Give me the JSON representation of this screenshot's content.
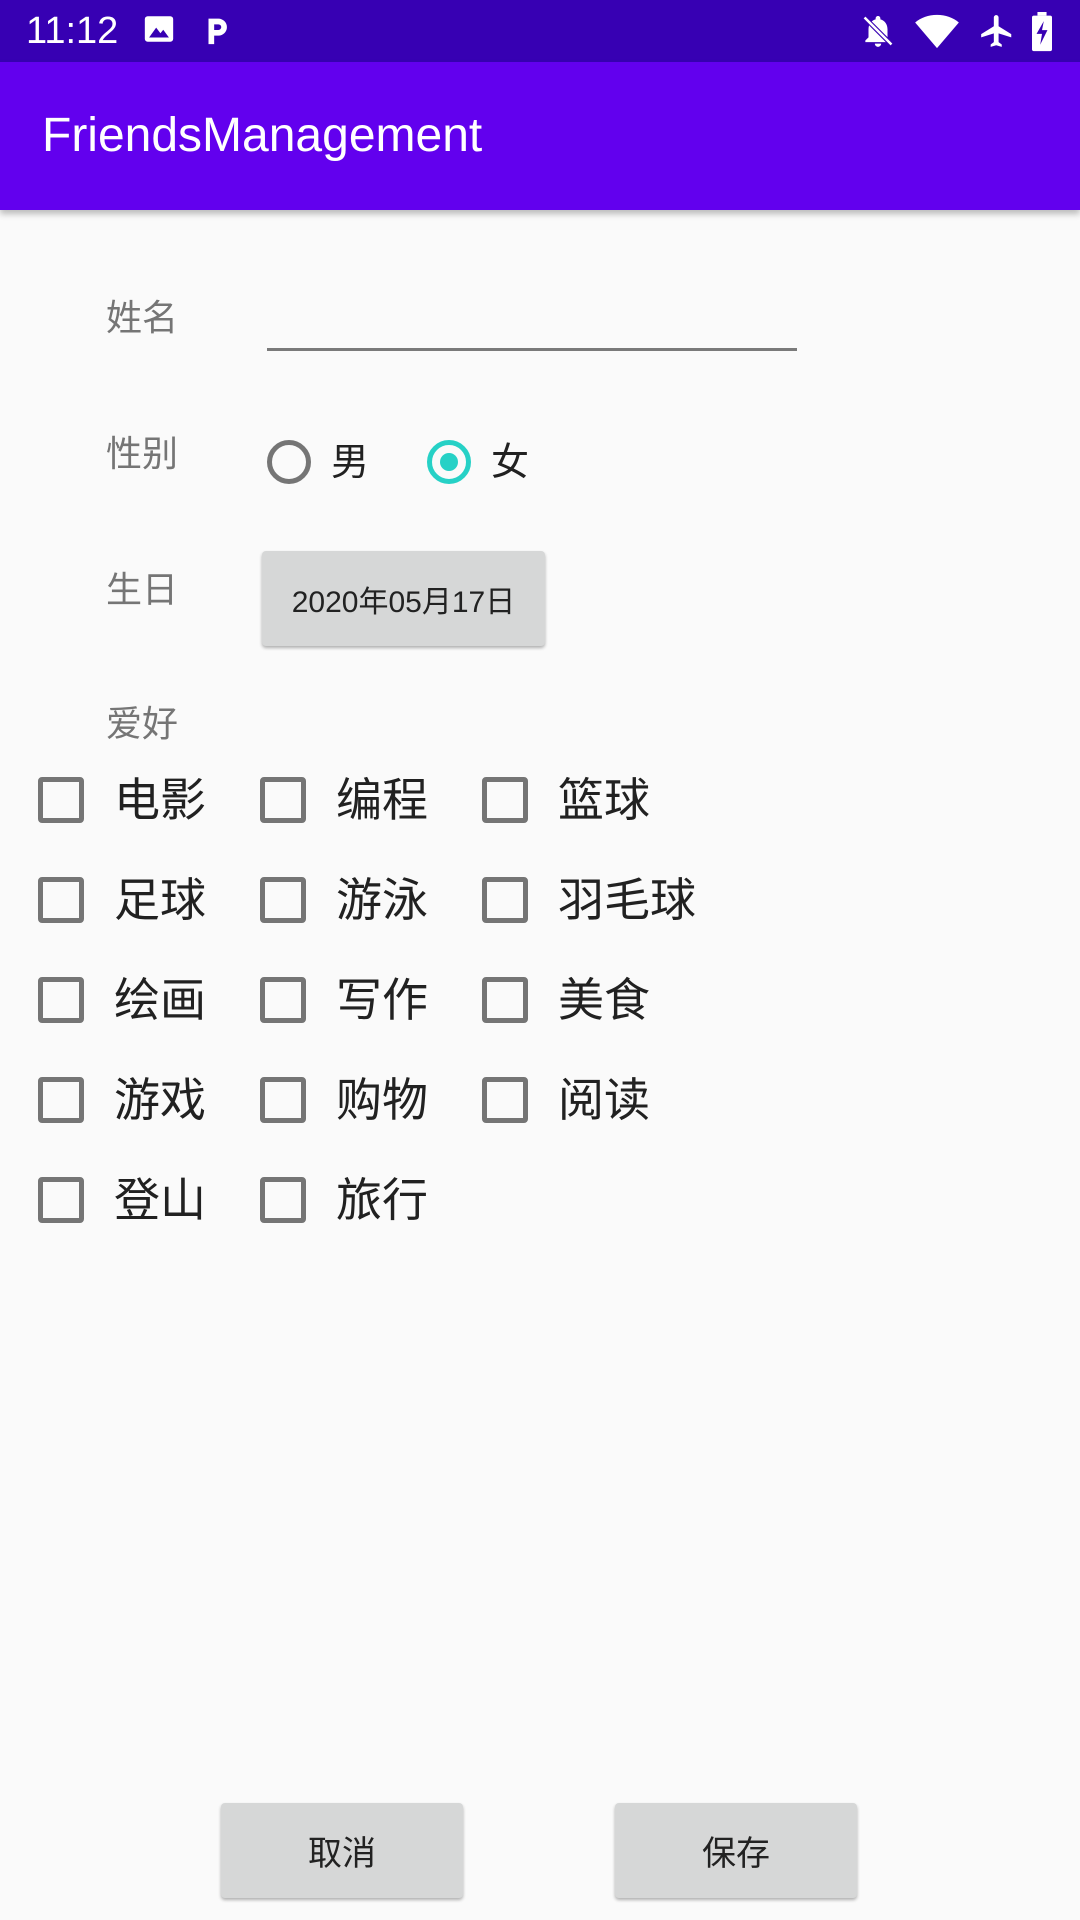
{
  "status_bar": {
    "time": "11:12",
    "icons": [
      "image-icon",
      "parking-icon",
      "notifications-off-icon",
      "wifi-icon",
      "airplane-icon",
      "battery-charging-icon"
    ]
  },
  "app_bar": {
    "title": "FriendsManagement"
  },
  "form": {
    "name_label": "姓名",
    "name_value": "",
    "gender_label": "性别",
    "gender_options": [
      "男",
      "女"
    ],
    "gender_selected": "女",
    "birthday_label": "生日",
    "birthday_value": "2020年05月17日",
    "hobbies_label": "爱好",
    "hobbies": [
      "电影",
      "编程",
      "篮球",
      "足球",
      "游泳",
      "羽毛球",
      "绘画",
      "写作",
      "美食",
      "游戏",
      "购物",
      "阅读",
      "登山",
      "旅行"
    ]
  },
  "actions": {
    "cancel_label": "取消",
    "save_label": "保存"
  },
  "colors": {
    "status_bar": "#3700b3",
    "app_bar": "#6200ee",
    "accent": "#26d1c6",
    "button": "#d6d7d7"
  }
}
